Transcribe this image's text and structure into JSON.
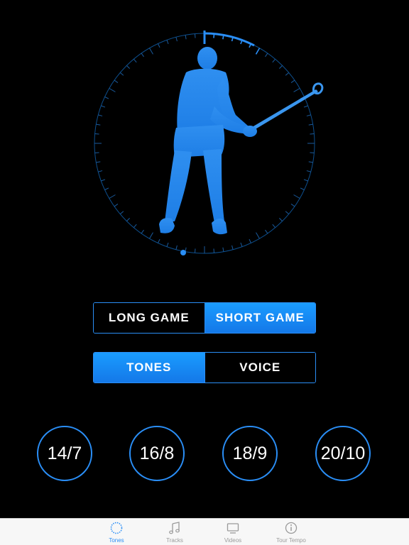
{
  "segment_game": {
    "long_label": "LONG GAME",
    "short_label": "SHORT GAME",
    "selected": "short"
  },
  "segment_audio": {
    "tones_label": "TONES",
    "voice_label": "VOICE",
    "selected": "tones"
  },
  "tempos": [
    "14/7",
    "16/8",
    "18/9",
    "20/10"
  ],
  "tabbar": {
    "items": [
      {
        "label": "Tones",
        "icon": "circle-dashed-icon",
        "active": true
      },
      {
        "label": "Tracks",
        "icon": "music-note-icon",
        "active": false
      },
      {
        "label": "Videos",
        "icon": "tv-icon",
        "active": false
      },
      {
        "label": "Tour Tempo",
        "icon": "info-icon",
        "active": false
      }
    ]
  },
  "colors": {
    "accent": "#2a8ef6",
    "selected_fill": "#1a8cff",
    "background": "#000000",
    "tabbar_bg": "#f7f7f7"
  }
}
